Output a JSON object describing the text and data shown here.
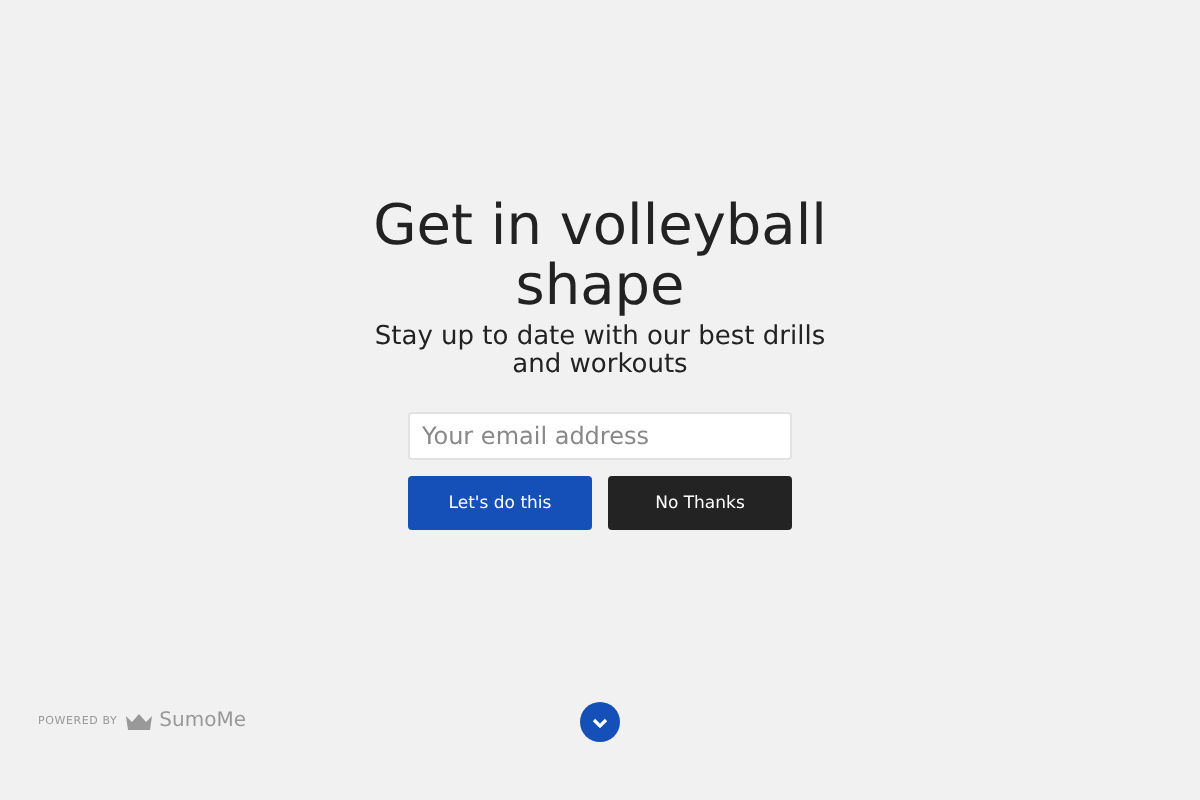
{
  "popup": {
    "title": "Get in volleyball shape",
    "subtitle": "Stay up to date with our best drills and workouts",
    "email": {
      "placeholder": "Your email address"
    },
    "buttons": [
      {
        "kind": "primary",
        "label": "Let's do this"
      },
      {
        "kind": "dismiss",
        "label": "No Thanks"
      }
    ]
  },
  "footer": {
    "powered_by": "POWERED BY",
    "brand": "SumoMe"
  }
}
